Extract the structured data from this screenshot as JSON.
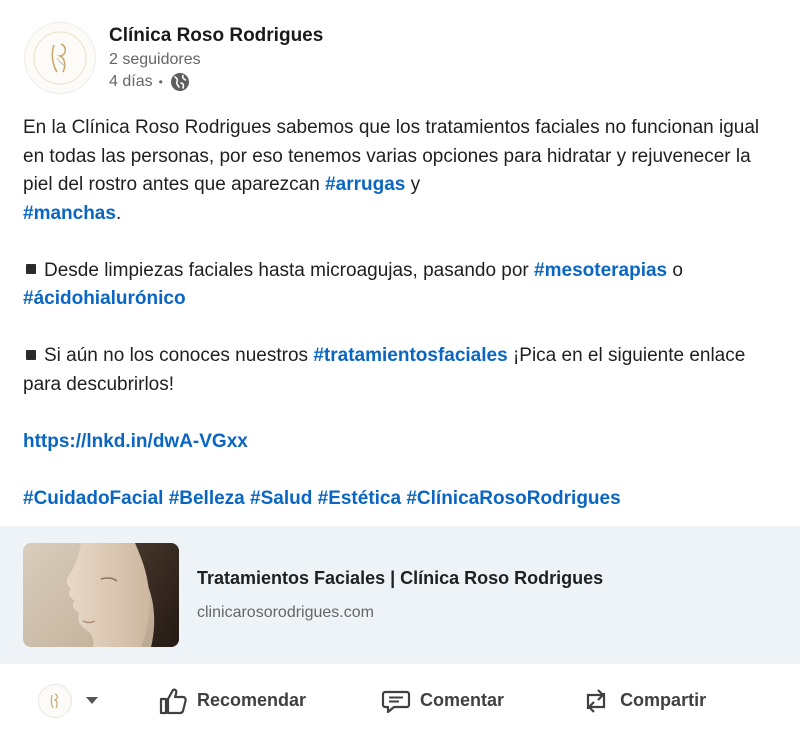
{
  "header": {
    "org_name": "Clínica Roso Rodrigues",
    "followers": "2 seguidores",
    "time": "4 días",
    "dot": "•"
  },
  "body": {
    "p1_text1": "En la Clínica Roso Rodrigues sabemos que los tratamientos faciales no funcionan igual en todas las personas, por eso tenemos varias opciones para hidratar y rejuvenecer la piel del rostro antes que aparezcan ",
    "p1_tag1": "#arrugas",
    "p1_text2": " y ",
    "p1_tag2": "#manchas",
    "p1_text3": ".",
    "p2_text1": "Desde limpiezas faciales hasta microagujas, pasando por ",
    "p2_tag1": "#mesoterapias",
    "p2_text2": " o ",
    "p2_tag2": "#ácidohialurónico",
    "p3_text1": "Si aún no los conoces nuestros ",
    "p3_tag1": "#tratamientosfaciales",
    "p3_text2": " ¡Pica en el siguiente enlace para descubrirlos!",
    "link": "https://lnkd.in/dwA-VGxx",
    "hashtags": [
      "#CuidadoFacial",
      "#Belleza",
      "#Salud",
      "#Estética",
      "#ClínicaRosoRodrigues"
    ]
  },
  "card": {
    "title": "Tratamientos Faciales | Clínica Roso Rodrigues",
    "domain": "clinicarosorodrigues.com"
  },
  "actions": {
    "like": "Recomendar",
    "comment": "Comentar",
    "share": "Compartir"
  },
  "colors": {
    "link": "#0a66c2",
    "card_bg": "#eef3f8",
    "logo_gold": "#c8a96a"
  }
}
